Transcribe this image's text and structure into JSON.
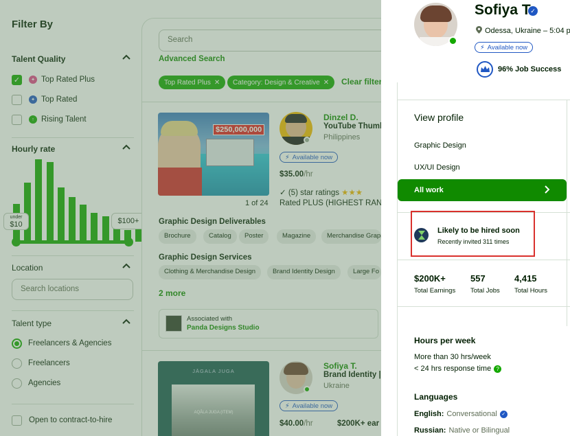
{
  "filters": {
    "title": "Filter By",
    "talent_quality": {
      "title": "Talent Quality",
      "options": [
        {
          "label": "Top Rated Plus",
          "checked": true,
          "badge_color": "#e0488a"
        },
        {
          "label": "Top Rated",
          "checked": false,
          "badge_color": "#1f57c3"
        },
        {
          "label": "Rising Talent",
          "checked": false,
          "badge_color": "#14a800"
        }
      ]
    },
    "hourly_rate": {
      "title": "Hourly rate",
      "histogram": [
        0.46,
        0.72,
        1.0,
        0.97,
        0.66,
        0.54,
        0.45,
        0.35,
        0.31,
        0.24,
        0.14,
        0.19,
        0.18
      ],
      "min_under": "under",
      "min_label": "$10",
      "max_label": "$100+"
    },
    "location": {
      "title": "Location",
      "placeholder": "Search locations"
    },
    "talent_type": {
      "title": "Talent type",
      "options": [
        {
          "label": "Freelancers & Agencies",
          "selected": true
        },
        {
          "label": "Freelancers",
          "selected": false
        },
        {
          "label": "Agencies",
          "selected": false
        }
      ]
    },
    "contract_to_hire": "Open to contract-to-hire"
  },
  "results": {
    "search_placeholder": "Search",
    "advanced_search": "Advanced Search",
    "chips": [
      "Top Rated Plus",
      "Category: Design & Creative"
    ],
    "clear_filters": "Clear filter",
    "card1": {
      "thumb_price": "$250,000,000",
      "pager": "1 of 24",
      "name": "Dinzel D.",
      "title": "YouTube Thumb",
      "location": "Philippines",
      "available": "Available now",
      "rate": "$35.00",
      "rate_unit": "/hr",
      "ratings": "(5) star ratings",
      "rated_plus": "Rated PLUS (HIGHEST RANK",
      "section1": "Graphic Design Deliverables",
      "skills1": [
        "Brochure",
        "Catalog",
        "Poster",
        "Magazine",
        "Merchandise Graphi"
      ],
      "section2": "Graphic Design Services",
      "skills2": [
        "Clothing & Merchandise Design",
        "Brand Identity Design",
        "Large Fo"
      ],
      "more": "2 more",
      "associated": "Associated with",
      "agency": "Panda Designs Studio"
    },
    "card2": {
      "thumb_title": "JĀGALA JUGA",
      "thumb_caption": "AQÂLA JUGA (ITEM)",
      "name": "Sofiya T.",
      "title": "Brand Identity |",
      "location": "Ukraine",
      "available": "Available now",
      "rate": "$40.00",
      "rate_unit": "/hr",
      "earned": "$200K+ ear"
    }
  },
  "profile": {
    "name": "Sofiya T.",
    "location": "Odessa, Ukraine – 5:04 p",
    "available": "Available now",
    "job_success": "96% Job Success",
    "view_profile": "View profile",
    "links": [
      "Graphic Design",
      "UX/UI Design"
    ],
    "all_work": "All work",
    "likely_title": "Likely to be hired soon",
    "likely_sub": "Recently invited 311 times",
    "stats": [
      {
        "value": "$200K+",
        "label": "Total Earnings"
      },
      {
        "value": "557",
        "label": "Total Jobs"
      },
      {
        "value": "4,415",
        "label": "Total Hours"
      }
    ],
    "hours_title": "Hours per week",
    "hours_value": "More than 30 hrs/week",
    "response": "< 24 hrs response time",
    "languages_title": "Languages",
    "languages": [
      {
        "name": "English:",
        "level": "Conversational"
      },
      {
        "name": "Russian:",
        "level": "Native or Bilingual"
      }
    ]
  },
  "colors": {
    "brand_green": "#14a800",
    "link_green": "#108a00",
    "blue": "#1f57c3",
    "highlight_red": "#d9302c"
  }
}
